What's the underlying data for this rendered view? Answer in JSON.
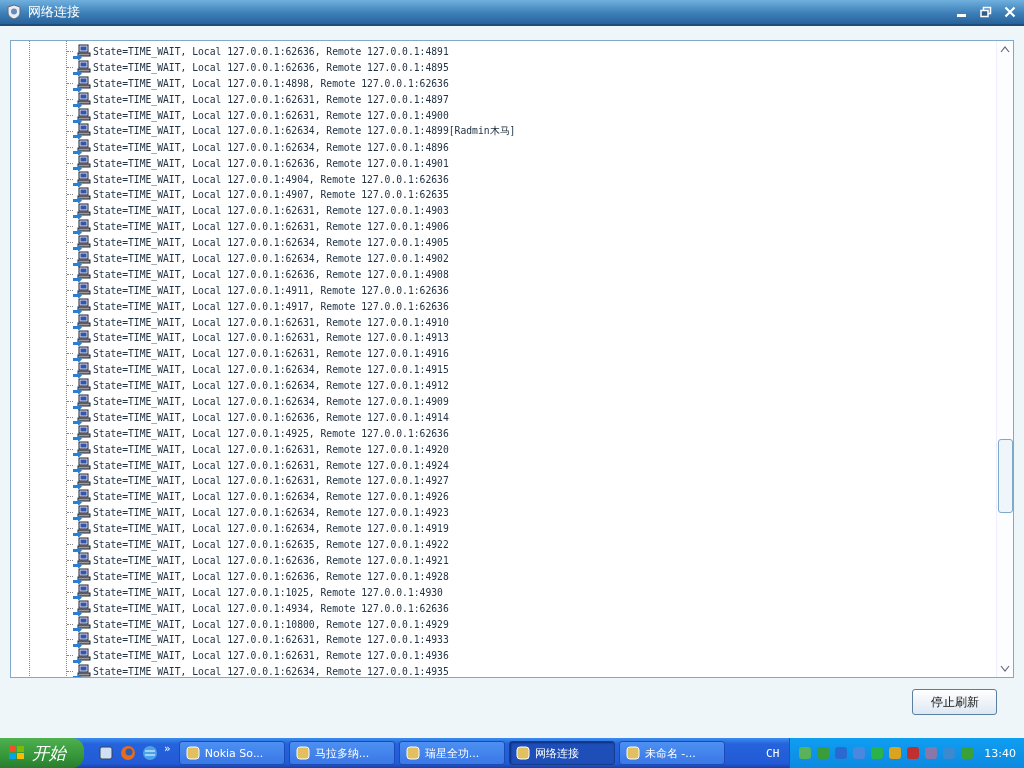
{
  "window": {
    "title": "网络连接"
  },
  "connections": [
    {
      "text": "State=TIME_WAIT, Local 127.0.0.1:62636, Remote 127.0.0.1:4891"
    },
    {
      "text": "State=TIME_WAIT, Local 127.0.0.1:62636, Remote 127.0.0.1:4895"
    },
    {
      "text": "State=TIME_WAIT, Local 127.0.0.1:4898, Remote 127.0.0.1:62636"
    },
    {
      "text": "State=TIME_WAIT, Local 127.0.0.1:62631, Remote 127.0.0.1:4897"
    },
    {
      "text": "State=TIME_WAIT, Local 127.0.0.1:62631, Remote 127.0.0.1:4900"
    },
    {
      "text": "State=TIME_WAIT, Local 127.0.0.1:62634, Remote 127.0.0.1:4899[Radmin木马]"
    },
    {
      "text": "State=TIME_WAIT, Local 127.0.0.1:62634, Remote 127.0.0.1:4896"
    },
    {
      "text": "State=TIME_WAIT, Local 127.0.0.1:62636, Remote 127.0.0.1:4901"
    },
    {
      "text": "State=TIME_WAIT, Local 127.0.0.1:4904, Remote 127.0.0.1:62636"
    },
    {
      "text": "State=TIME_WAIT, Local 127.0.0.1:4907, Remote 127.0.0.1:62635"
    },
    {
      "text": "State=TIME_WAIT, Local 127.0.0.1:62631, Remote 127.0.0.1:4903"
    },
    {
      "text": "State=TIME_WAIT, Local 127.0.0.1:62631, Remote 127.0.0.1:4906"
    },
    {
      "text": "State=TIME_WAIT, Local 127.0.0.1:62634, Remote 127.0.0.1:4905"
    },
    {
      "text": "State=TIME_WAIT, Local 127.0.0.1:62634, Remote 127.0.0.1:4902"
    },
    {
      "text": "State=TIME_WAIT, Local 127.0.0.1:62636, Remote 127.0.0.1:4908"
    },
    {
      "text": "State=TIME_WAIT, Local 127.0.0.1:4911, Remote 127.0.0.1:62636"
    },
    {
      "text": "State=TIME_WAIT, Local 127.0.0.1:4917, Remote 127.0.0.1:62636"
    },
    {
      "text": "State=TIME_WAIT, Local 127.0.0.1:62631, Remote 127.0.0.1:4910"
    },
    {
      "text": "State=TIME_WAIT, Local 127.0.0.1:62631, Remote 127.0.0.1:4913"
    },
    {
      "text": "State=TIME_WAIT, Local 127.0.0.1:62631, Remote 127.0.0.1:4916"
    },
    {
      "text": "State=TIME_WAIT, Local 127.0.0.1:62634, Remote 127.0.0.1:4915"
    },
    {
      "text": "State=TIME_WAIT, Local 127.0.0.1:62634, Remote 127.0.0.1:4912"
    },
    {
      "text": "State=TIME_WAIT, Local 127.0.0.1:62634, Remote 127.0.0.1:4909"
    },
    {
      "text": "State=TIME_WAIT, Local 127.0.0.1:62636, Remote 127.0.0.1:4914"
    },
    {
      "text": "State=TIME_WAIT, Local 127.0.0.1:4925, Remote 127.0.0.1:62636"
    },
    {
      "text": "State=TIME_WAIT, Local 127.0.0.1:62631, Remote 127.0.0.1:4920"
    },
    {
      "text": "State=TIME_WAIT, Local 127.0.0.1:62631, Remote 127.0.0.1:4924"
    },
    {
      "text": "State=TIME_WAIT, Local 127.0.0.1:62631, Remote 127.0.0.1:4927"
    },
    {
      "text": "State=TIME_WAIT, Local 127.0.0.1:62634, Remote 127.0.0.1:4926"
    },
    {
      "text": "State=TIME_WAIT, Local 127.0.0.1:62634, Remote 127.0.0.1:4923"
    },
    {
      "text": "State=TIME_WAIT, Local 127.0.0.1:62634, Remote 127.0.0.1:4919"
    },
    {
      "text": "State=TIME_WAIT, Local 127.0.0.1:62635, Remote 127.0.0.1:4922"
    },
    {
      "text": "State=TIME_WAIT, Local 127.0.0.1:62636, Remote 127.0.0.1:4921"
    },
    {
      "text": "State=TIME_WAIT, Local 127.0.0.1:62636, Remote 127.0.0.1:4928"
    },
    {
      "text": "State=TIME_WAIT, Local 127.0.0.1:1025, Remote 127.0.0.1:4930"
    },
    {
      "text": "State=TIME_WAIT, Local 127.0.0.1:4934, Remote 127.0.0.1:62636"
    },
    {
      "text": "State=TIME_WAIT, Local 127.0.0.1:10800, Remote 127.0.0.1:4929"
    },
    {
      "text": "State=TIME_WAIT, Local 127.0.0.1:62631, Remote 127.0.0.1:4933"
    },
    {
      "text": "State=TIME_WAIT, Local 127.0.0.1:62631, Remote 127.0.0.1:4936"
    },
    {
      "text": "State=TIME_WAIT, Local 127.0.0.1:62634, Remote 127.0.0.1:4935"
    }
  ],
  "buttons": [
    {
      "label": "停止刷新"
    }
  ],
  "taskbar": {
    "start": "开始",
    "quick_launch_more": "»",
    "tasks": [
      {
        "label": "Nokia So...",
        "selected": false
      },
      {
        "label": "马拉多纳...",
        "selected": false
      },
      {
        "label": "瑞星全功...",
        "selected": false
      },
      {
        "label": "网络连接",
        "selected": true
      },
      {
        "label": "未命名 -...",
        "selected": false
      }
    ],
    "language": "CH",
    "clock": "13:40"
  }
}
